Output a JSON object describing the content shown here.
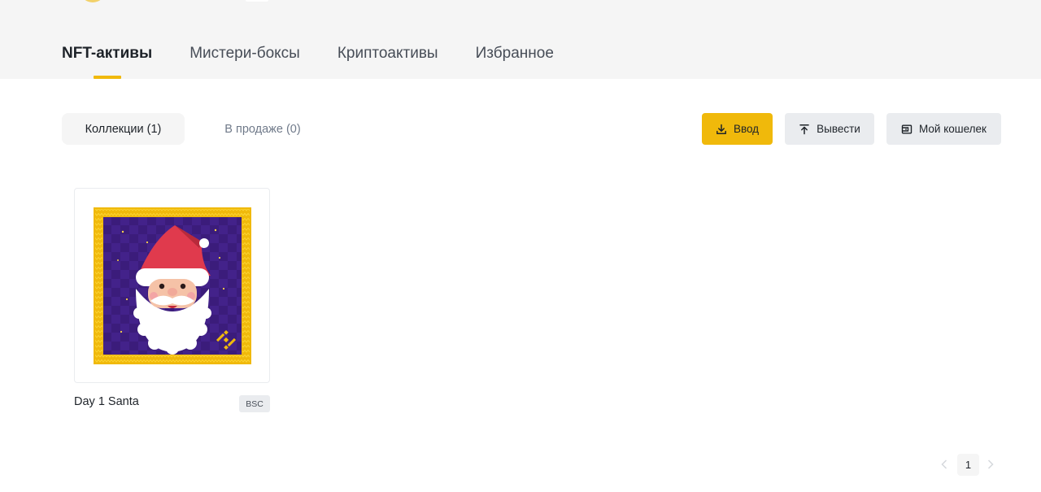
{
  "main_tabs": [
    {
      "label": "NFT-активы",
      "active": true
    },
    {
      "label": "Мистери-боксы",
      "active": false
    },
    {
      "label": "Криптоактивы",
      "active": false
    },
    {
      "label": "Избранное",
      "active": false
    }
  ],
  "sub_tabs": {
    "collections": "Коллекции (1)",
    "on_sale": "В продаже (0)"
  },
  "actions": {
    "deposit": {
      "label": "Ввод",
      "icon": "download-icon"
    },
    "withdraw": {
      "label": "Вывести",
      "icon": "upload-icon"
    },
    "wallet": {
      "label": "Мой кошелек",
      "icon": "wallet-icon"
    }
  },
  "items": [
    {
      "title": "Day 1 Santa",
      "chain": "BSC",
      "image": "santa-nft-art"
    }
  ],
  "pagination": {
    "current": "1"
  },
  "colors": {
    "accent": "#f0b90b",
    "band": "#f5f5f5",
    "button_gray": "#eaecef",
    "art_frame": "#f0b90b",
    "art_bg": "#3a1d7a"
  }
}
